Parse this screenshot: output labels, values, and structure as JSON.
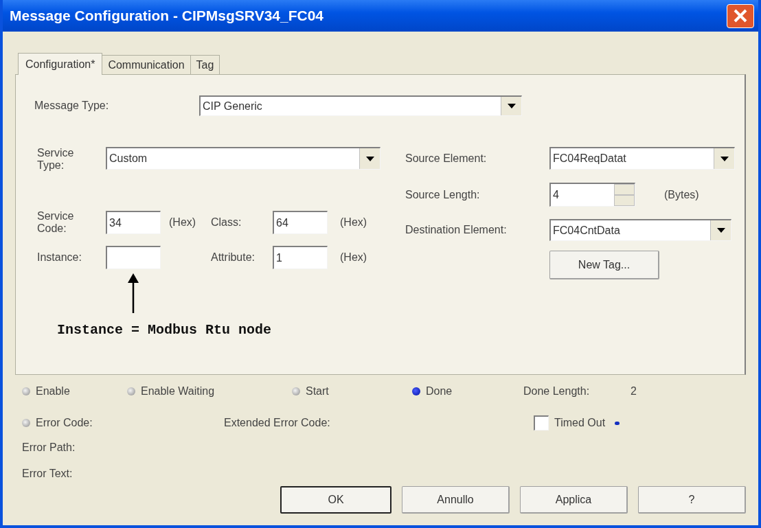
{
  "window": {
    "title": "Message Configuration - CIPMsgSRV34_FC04"
  },
  "tabs": [
    {
      "label": "Configuration*",
      "selected": true
    },
    {
      "label": "Communication",
      "selected": false
    },
    {
      "label": "Tag",
      "selected": false
    }
  ],
  "message_type": {
    "label": "Message Type:",
    "value": "CIP Generic"
  },
  "service_type": {
    "label": "Service Type:",
    "value": "Custom"
  },
  "service_code": {
    "label": "Service Code:",
    "value": "34",
    "unit": "(Hex)"
  },
  "class": {
    "label": "Class:",
    "value": "64",
    "unit": "(Hex)"
  },
  "instance": {
    "label": "Instance:"
  },
  "attribute": {
    "label": "Attribute:",
    "value": "1",
    "unit": "(Hex)"
  },
  "annotation": "Instance = Modbus Rtu node",
  "source_element": {
    "label": "Source Element:",
    "value": "FC04ReqDatat"
  },
  "source_length": {
    "label": "Source Length:",
    "value": "4",
    "unit": "(Bytes)"
  },
  "destination_element": {
    "label": "Destination Element:",
    "value": "FC04CntData"
  },
  "new_tag_button": "New Tag...",
  "status_indicators": [
    {
      "label": "Enable",
      "on": false
    },
    {
      "label": "Enable Waiting",
      "on": false
    },
    {
      "label": "Start",
      "on": false
    },
    {
      "label": "Done",
      "on": true
    }
  ],
  "done_length": {
    "label": "Done Length:",
    "value": "2"
  },
  "error_code": {
    "label": "Error Code:",
    "on": false
  },
  "extended_error_code": {
    "label": "Extended Error Code:"
  },
  "timed_out": {
    "label": "Timed Out",
    "checked": false,
    "indicator_on": true
  },
  "error_path": {
    "label": "Error Path:"
  },
  "error_text": {
    "label": "Error Text:"
  },
  "buttons": [
    {
      "label": "OK",
      "default": true
    },
    {
      "label": "Annullo",
      "default": false
    },
    {
      "label": "Applica",
      "default": false
    },
    {
      "label": "?",
      "default": false
    }
  ]
}
